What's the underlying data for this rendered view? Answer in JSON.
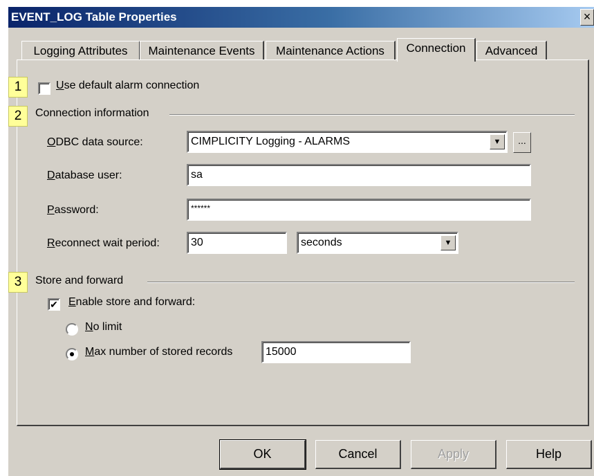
{
  "window": {
    "title": "EVENT_LOG Table Properties",
    "close": "×"
  },
  "tabs": [
    {
      "label": "Logging Attributes"
    },
    {
      "label": "Maintenance Events"
    },
    {
      "label": "Maintenance Actions"
    },
    {
      "label": "Connection"
    },
    {
      "label": "Advanced"
    }
  ],
  "badges": [
    "1",
    "2",
    "3"
  ],
  "default_alarm": {
    "label": "Use default alarm connection",
    "checked": false
  },
  "connection_info": {
    "heading": "Connection information",
    "odbc_label": "ODBC data source:",
    "odbc_value": "CIMPLICITY Logging - ALARMS",
    "browse_label": "...",
    "user_label": "Database user:",
    "user_value": "sa",
    "password_label": "Password:",
    "password_value": "******",
    "reconnect_label": "Reconnect wait period:",
    "reconnect_value": "30",
    "reconnect_unit": "seconds"
  },
  "store_forward": {
    "heading": "Store and forward",
    "enable_label": "Enable store and forward:",
    "enable_checked": true,
    "no_limit_label": "No limit",
    "max_label": "Max number of stored records",
    "max_value": "15000",
    "selected": "max"
  },
  "buttons": {
    "ok": "OK",
    "cancel": "Cancel",
    "apply": "Apply",
    "help": "Help"
  },
  "colors": {
    "badge": "#ffff99",
    "title_bar": "#0a246a",
    "dialog_bg": "#d4d0c8"
  }
}
